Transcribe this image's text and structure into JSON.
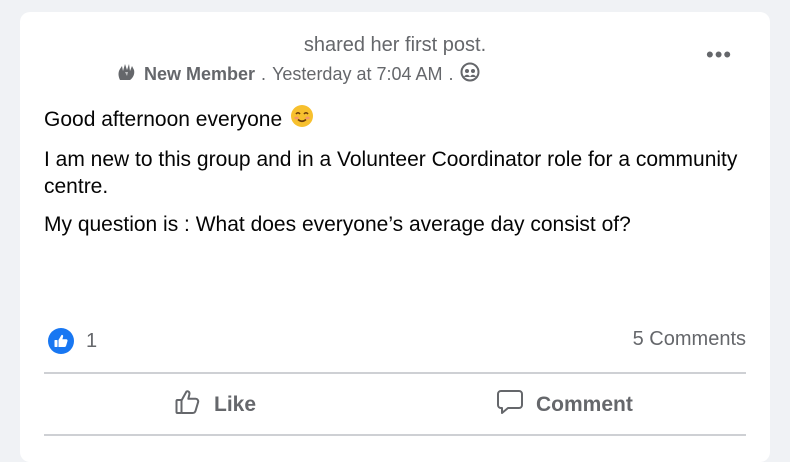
{
  "post": {
    "shared_text": "shared her first post.",
    "badge_label": "New Member",
    "separator1": ".",
    "timestamp": "Yesterday at 7:04 AM",
    "separator2": ".",
    "audience_icon": "group-globe-icon",
    "more_label": "•••",
    "body": {
      "greeting": "Good afternoon everyone",
      "emoji": "smiling-face-icon",
      "paragraph1": "I am new to this group and in a Volunteer Coordinator role for a community centre.",
      "paragraph2": "My question is : What does everyone’s average day consist of?"
    },
    "reactions": {
      "icon": "thumbs-up-reaction-icon",
      "count": "1"
    },
    "comments_label": "5 Comments",
    "actions": {
      "like_label": "Like",
      "comment_label": "Comment"
    }
  },
  "colors": {
    "background": "#f0f2f5",
    "card": "#ffffff",
    "secondary_text": "#65676b",
    "primary_text": "#050505",
    "accent": "#1877f2"
  }
}
